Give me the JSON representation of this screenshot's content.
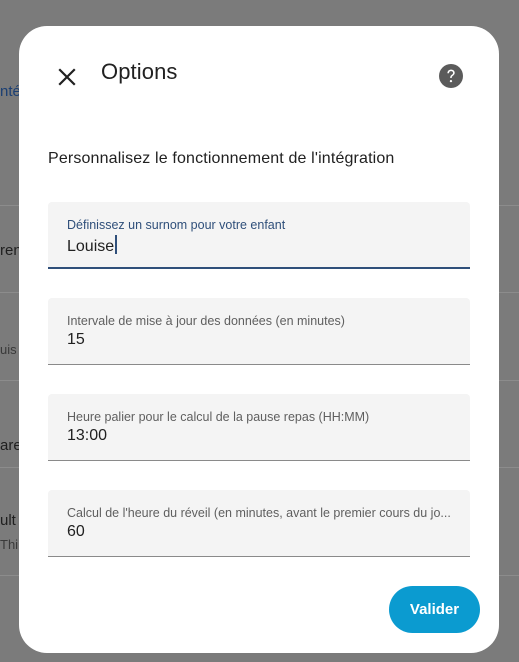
{
  "background": {
    "fragments": [
      {
        "text": "nté"
      },
      {
        "text": "ren"
      },
      {
        "text": "uis"
      },
      {
        "text": "are"
      },
      {
        "text": "ult"
      },
      {
        "text": "Thi"
      }
    ]
  },
  "dialog": {
    "title": "Options",
    "close_icon": "close-icon",
    "help_icon": "help-circle-icon",
    "description": "Personnalisez le fonctionnement de l'intégration",
    "fields": [
      {
        "label": "Définissez un surnom pour votre enfant",
        "value": "Louise"
      },
      {
        "label": "Intervale de mise à jour des données (en minutes)",
        "value": "15"
      },
      {
        "label": "Heure palier pour le calcul de la pause repas (HH:MM)",
        "value": "13:00"
      },
      {
        "label": "Calcul de l'heure du réveil (en minutes, avant le premier cours du jo...",
        "value": "60"
      }
    ],
    "submit_label": "Valider"
  },
  "colors": {
    "accent": "#0b9bd0",
    "focus": "#2f4f7a",
    "scrim": "#7a7a7a"
  }
}
